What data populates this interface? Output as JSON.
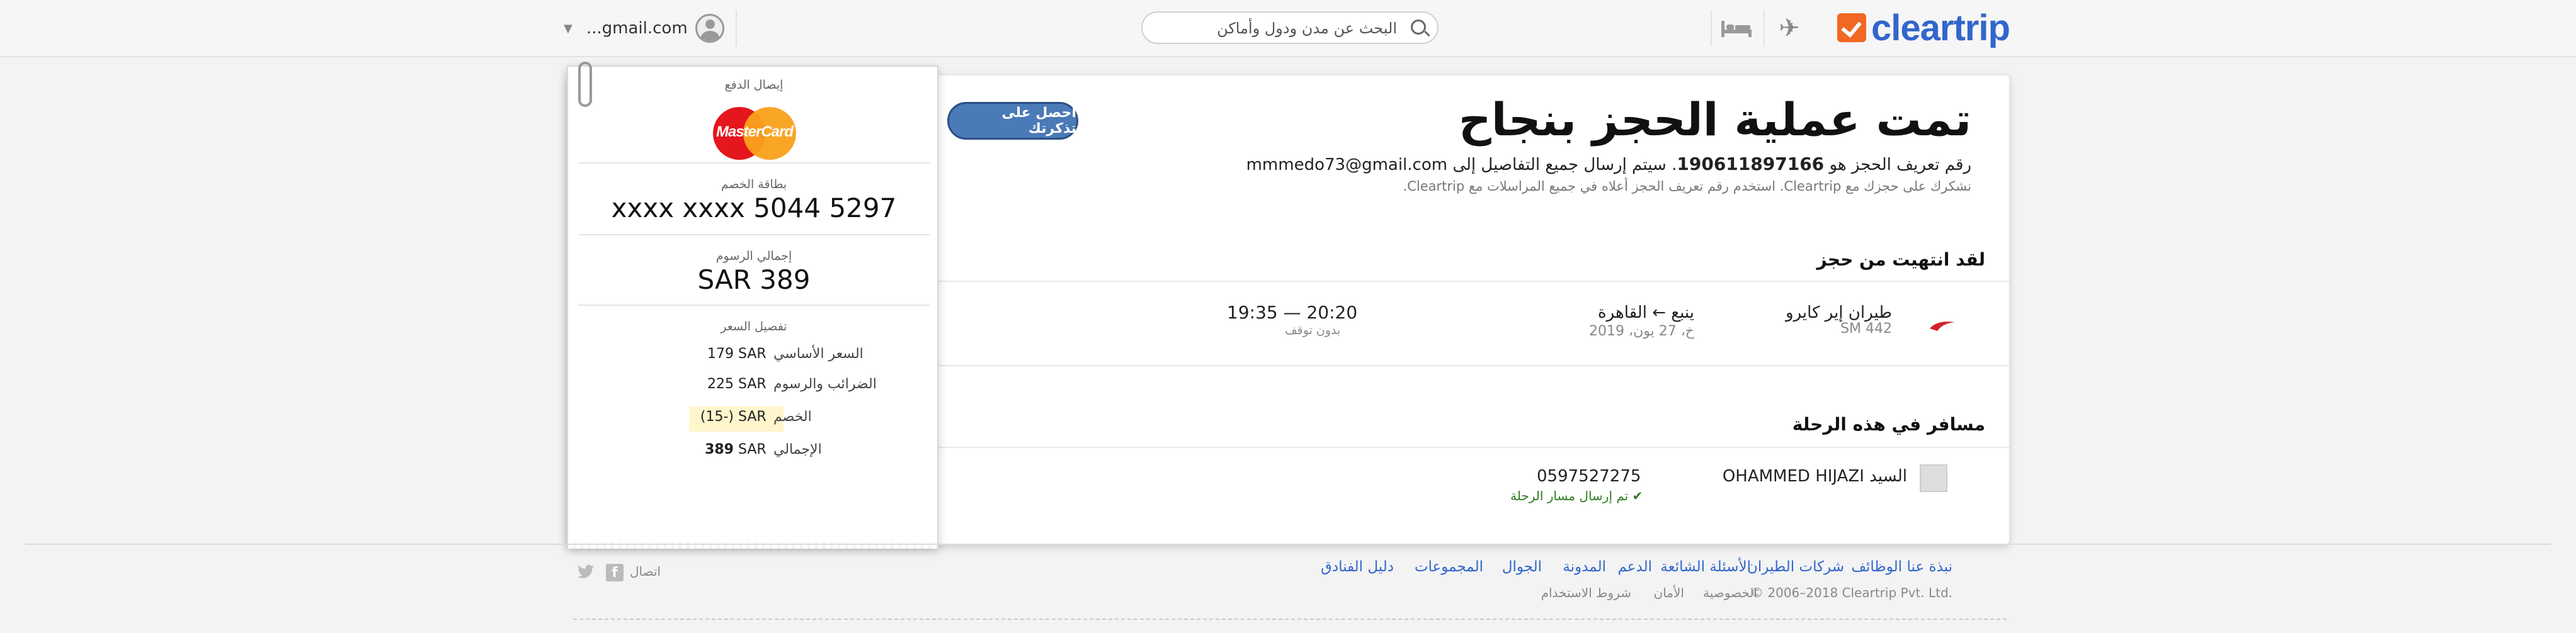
{
  "header": {
    "logo_text": "cleartrip",
    "search_placeholder": "البحث عن مدن ودول وأماكن",
    "account_email": "...gmail.com",
    "icons": [
      "flight-icon",
      "hotel-icon",
      "search-icon",
      "avatar"
    ]
  },
  "booking": {
    "title": "تمت عملية الحجز بنجاح",
    "get_ticket_label": "احصل على تذكرتك",
    "trip_id_prefix": "رقم تعريف الحجز هو",
    "trip_id": "190611897166",
    "trip_id_suffix": ". سيتم إرسال جميع التفاصيل إلى",
    "email": "mmmedo73@gmail.com",
    "thanks": "نشكرك على حجزك مع Cleartrip. استخدم رقم تعريف الحجز أعلاه في جميع المراسلات مع Cleartrip."
  },
  "itinerary": {
    "section_title": "لقد انتهيت من حجز",
    "airline_name": "طيران إير كايرو",
    "flight_code": "SM 442",
    "route": "ينبع ← القاهرة",
    "date": "خ، 27 يون، 2019",
    "time": "19:35 — 20:20",
    "stops": "بدون توقف"
  },
  "passengers": {
    "section_title": "مسافر في هذه الرحلة",
    "name": "السيد OHAMMED HIJAZI",
    "phone": "0597527275",
    "sent_status": "تم إرسال مسار الرحلة"
  },
  "receipt": {
    "title": "إيصال الدفع",
    "card_brand": "MasterCard",
    "card_label": "بطاقة الخصم",
    "card_number": "xxxx xxxx 5044 5297",
    "total_label": "إجمالي الرسوم",
    "total_value": "SAR 389",
    "breakdown_label": "تفصيل السعر",
    "rows": [
      {
        "label": "السعر الأساسي",
        "currency": "SAR",
        "amount": "179"
      },
      {
        "label": "الضرائب والرسوم",
        "currency": "SAR",
        "amount": "225"
      },
      {
        "label": "الخصم",
        "currency": "SAR",
        "amount": "(15-)"
      },
      {
        "label": "الإجمالي",
        "currency": "SAR",
        "amount": "389"
      }
    ]
  },
  "footer": {
    "nav": [
      "نبذة عنا",
      "الوظائف",
      "شركات الطيران",
      "الأسئلة الشائعة",
      "الدعم",
      "المدونة",
      "الجوال",
      "المجموعات",
      "دليل الفنادق"
    ],
    "copyright": "© 2006–2018 Cleartrip Pvt. Ltd.",
    "privacy": "الخصوصية",
    "security": "الأمان",
    "terms": "شروط الاستخدام",
    "connect": "اتصال"
  }
}
